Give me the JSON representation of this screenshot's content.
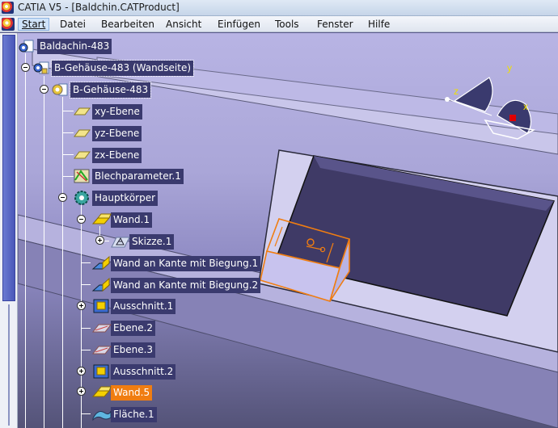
{
  "window": {
    "title": "CATIA V5 - [Baldchin.CATProduct]"
  },
  "menu": [
    {
      "label": "Start",
      "active": true
    },
    {
      "label": "Datei"
    },
    {
      "label": "Bearbeiten"
    },
    {
      "label": "Ansicht"
    },
    {
      "label": "Einfügen"
    },
    {
      "label": "Tools"
    },
    {
      "label": "Fenster"
    },
    {
      "label": "Hilfe"
    }
  ],
  "compass": {
    "x_label": "x",
    "y_label": "y",
    "z_label": "z"
  },
  "tree": {
    "root": "Baldachin-483",
    "product": "B-Gehäuse-483 (Wandseite)",
    "part": "B-Gehäuse-483",
    "xy_plane": "xy-Ebene",
    "yz_plane": "yz-Ebene",
    "zx_plane": "zx-Ebene",
    "sheet_params": "Blechparameter.1",
    "main_body": "Hauptkörper",
    "wall1": "Wand.1",
    "sketch1": "Skizze.1",
    "edge_wall1": "Wand an Kante mit Biegung.1",
    "edge_wall2": "Wand an Kante mit Biegung.2",
    "cutout1": "Ausschnitt.1",
    "plane2": "Ebene.2",
    "plane3": "Ebene.3",
    "cutout2": "Ausschnitt.2",
    "wall5": "Wand.5",
    "surface1": "Fläche.1"
  },
  "colors": {
    "selection": "#f07d11",
    "tree_label_bg": "#3a3a6e",
    "viewport_top": "#b8b4e4"
  }
}
